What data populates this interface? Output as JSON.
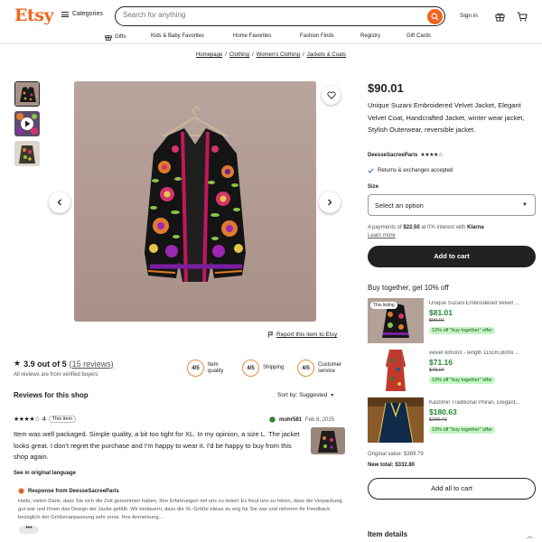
{
  "header": {
    "logo": "Etsy",
    "categories_label": "Categories",
    "search_placeholder": "Search for anything",
    "signin_label": "Sign in"
  },
  "nav": {
    "items": [
      {
        "label": "Gifts",
        "icon": "gift-icon"
      },
      {
        "label": "Kids & Baby Favorites"
      },
      {
        "label": "Home Favorites"
      },
      {
        "label": "Fashion Finds"
      },
      {
        "label": "Registry"
      },
      {
        "label": "Gift Cards"
      }
    ]
  },
  "breadcrumb": [
    "Homepage",
    "Clothing",
    "Women's Clothing",
    "Jackets & Coats"
  ],
  "gallery": {
    "report_label": "Report this item to Etsy"
  },
  "reviews_summary": {
    "rating_text": "3.9 out of 5",
    "count_text": "(15 reviews)",
    "verified_text": "All reviews are from verified buyers",
    "stars": 4,
    "metrics": [
      {
        "score": "4/5",
        "label_line1": "Item",
        "label_line2": "quality"
      },
      {
        "score": "4/5",
        "label_line1": "Shipping",
        "label_line2": ""
      },
      {
        "score": "4/5",
        "label_line1": "Customer",
        "label_line2": "service"
      }
    ]
  },
  "reviews": {
    "title": "Reviews for this shop",
    "sort_label": "Sort by: Suggested",
    "items": [
      {
        "stars": 4,
        "rating": "4",
        "tag": "This item",
        "reviewer": "mohr581",
        "date": "Feb 8, 2025",
        "text": "Item was well packaged. Simple quality, a bit too tight for XL. In my opinion, a size L. The jacket looks great. I don't regret the purchase and I'm happy to wear it. I'd be happy to buy from this shop again.",
        "see_original": "See in original language",
        "response_header": "Response from DeesseSacreeParis",
        "response_text": "Hallo, vielen Dank, dass Sie sich die Zeit genommen haben, Ihre Erfahrungen mit uns zu teilen! Es freut uns zu hören, dass die Verpackung gut war und Ihnen das Design der Jacke gefällt. Wir bedauern, dass die XL-Größe etwas zu eng für Sie war und nehmen Ihr Feedback bezüglich der Größenanpassung sehr ernst. Ihre Anmerkung...",
        "more_label": "•••"
      }
    ]
  },
  "product": {
    "price": "$90.01",
    "title": "Unique Suzani Embroidered Velvet Jacket, Elegant Velvet Coat, Handcrafted Jacket, winter wear jacket, Stylish Outerwear, reversible jacket.",
    "shop_name": "DeesseSacreeParis",
    "shop_stars": 4,
    "returns_text": "Returns & exchanges accepted",
    "size_label": "Size",
    "size_select_value": "Select an option",
    "klarna_text_pre": "4 payments of ",
    "klarna_amount": "$22.50",
    "klarna_text_post": " at 0% interest with ",
    "klarna_brand": "Klarna",
    "learn_more": "Learn more",
    "add_to_cart": "Add to cart"
  },
  "bundle": {
    "title": "Buy together, get 10% off",
    "this_listing_tag": "This listing",
    "items": [
      {
        "title": "Unique Suzani Embroidered Velvet ...",
        "price": "$81.01",
        "orig": "$90.01",
        "badge": "10% off \"buy together\" offer"
      },
      {
        "title": "velvet kimono - length 115cm,Boho ...",
        "price": "$71.16",
        "orig": "$79.07",
        "badge": "10% off \"buy together\" offer"
      },
      {
        "title": "Kashmiri Traditional Phiran, Elegant...",
        "price": "$180.63",
        "orig": "$200.71",
        "badge": "10% off \"buy together\" offer"
      }
    ],
    "original_value": "Original value: $369.79",
    "new_total": "New total: $332.80",
    "add_all_label": "Add all to cart"
  },
  "item_details_label": "Item details",
  "colors": {
    "brand": "#f1641e",
    "star": "#222222",
    "sale_green": "#258635",
    "badge_green": "#c3f5c2",
    "metric_ring": "#e58e3b"
  }
}
